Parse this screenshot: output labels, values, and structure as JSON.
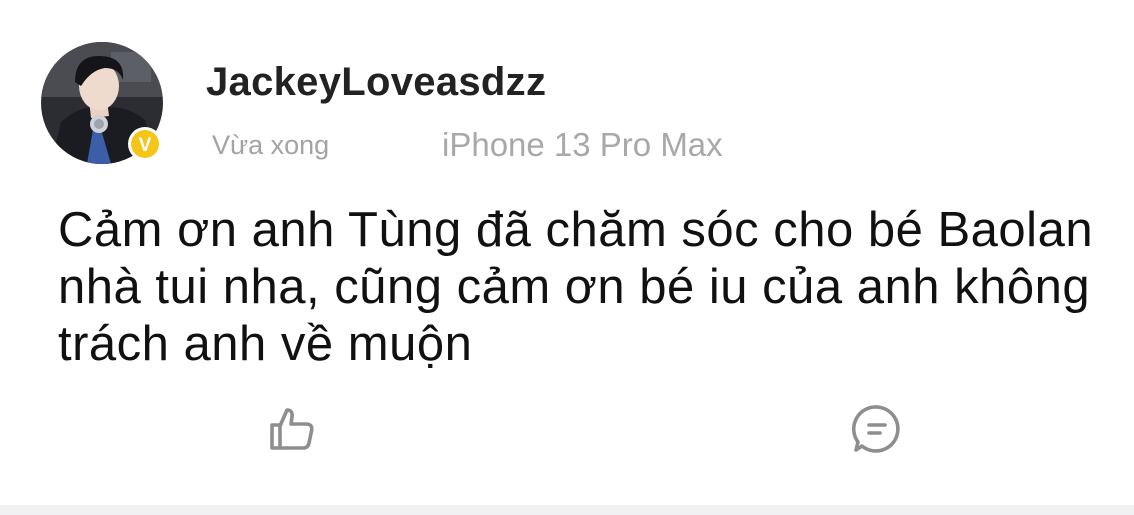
{
  "post": {
    "author": {
      "username": "JackeyLoveasdzz",
      "verified_badge_letter": "V",
      "avatar_icon": "user-photo-avatar",
      "badge_color": "#f5c518"
    },
    "timestamp": "Vừa xong",
    "device": "iPhone 13 Pro Max",
    "text": "Cảm ơn anh Tùng đã chăm sóc cho bé Baolan nhà tui nha, cũng cảm ơn bé iu của anh không trách anh về muộn"
  },
  "actions": {
    "like_icon": "thumbs-up-icon",
    "comment_icon": "comment-icon",
    "icon_color": "#8e8e8e"
  }
}
